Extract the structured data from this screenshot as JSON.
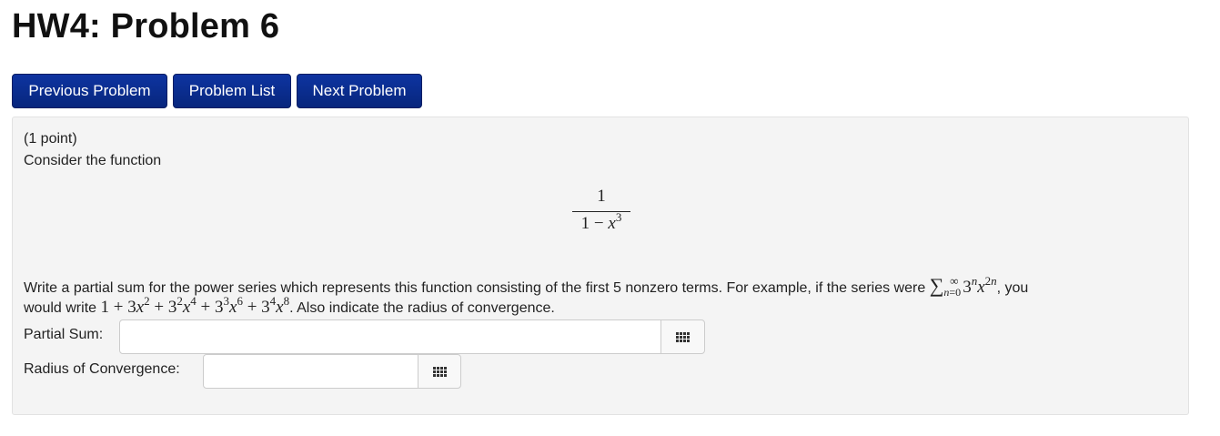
{
  "title": "HW4: Problem 6",
  "nav": {
    "previous": "Previous Problem",
    "list": "Problem List",
    "next": "Next Problem"
  },
  "problem": {
    "points": "(1 point)",
    "intro": "Consider the function",
    "fraction": {
      "numerator": "1",
      "denominator": "1 − x³"
    },
    "instructions_part1": "Write a partial sum for the power series which represents this function consisting of the first 5 nonzero terms. For example, if the series were ",
    "example_series": "Σ_{n=0}^{∞} 3^n x^{2n}",
    "instructions_part2": ", you",
    "instructions_line2_a": "would write ",
    "example_sum": "1 + 3x² + 3²x⁴ + 3³x⁶ + 3⁴x⁸",
    "instructions_line2_b": ". Also indicate the radius of convergence.",
    "partial_sum_label": "Partial Sum:",
    "partial_sum_value": "",
    "radius_label": "Radius of Convergence:",
    "radius_value": ""
  },
  "icons": {
    "keyboard": "equation-editor-icon"
  }
}
